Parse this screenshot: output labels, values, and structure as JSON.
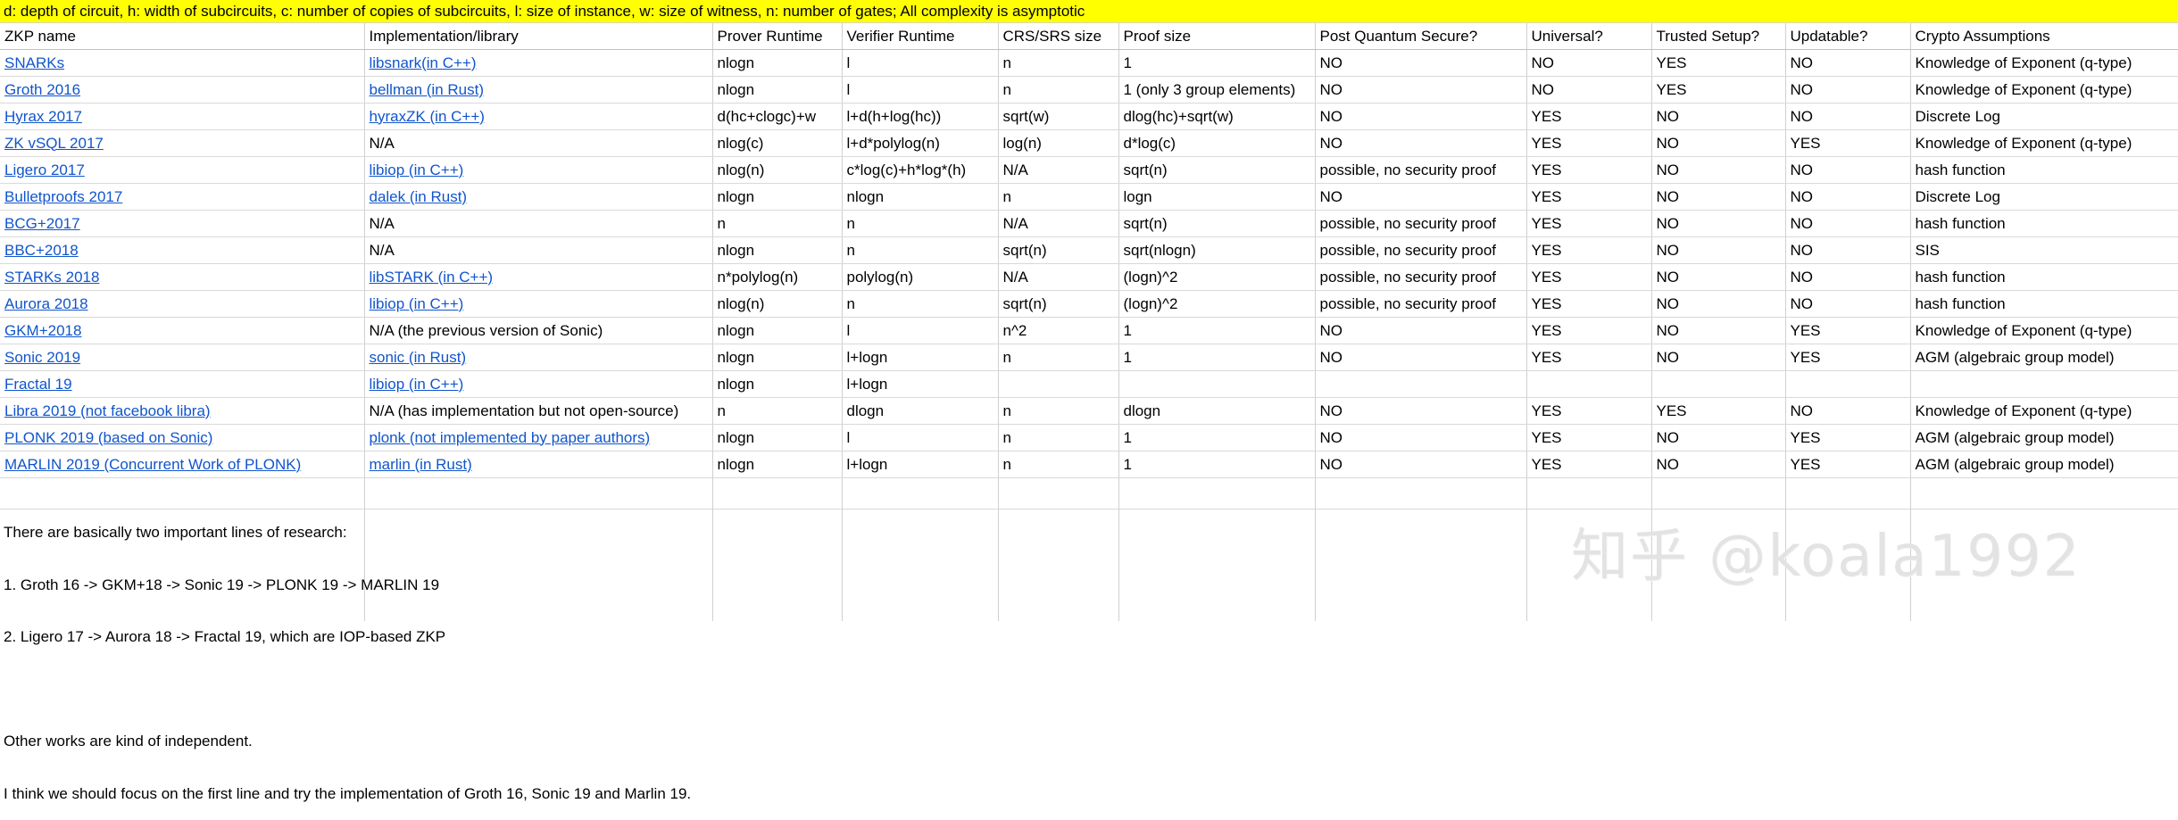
{
  "legend": {
    "text": "d: depth of circuit, h: width of subcircuits, c: number of copies of subcircuits, l: size of instance, w: size of witness, n: number of gates; All complexity is asymptotic",
    "background": "#ffff00"
  },
  "table": {
    "columns": [
      "ZKP name",
      "Implementation/library",
      "Prover Runtime",
      "Verifier Runtime",
      "CRS/SRS size",
      "Proof size",
      "Post Quantum Secure?",
      "Universal?",
      "Trusted Setup?",
      "Updatable?",
      "Crypto Assumptions"
    ],
    "link_color": "#1155cc",
    "rows": [
      {
        "name": "SNARKs ",
        "name_link": true,
        "impl": "libsnark(in C++)",
        "impl_link": true,
        "prover": "nlogn",
        "verifier": "l",
        "crs": "n",
        "proof": "1",
        "proof_numeric": true,
        "pq": "NO",
        "universal": "NO",
        "trusted": "YES",
        "updatable": "NO",
        "crypto": "Knowledge of Exponent (q-type)"
      },
      {
        "name": "Groth 2016",
        "name_link": true,
        "impl": "bellman (in Rust)",
        "impl_link": true,
        "prover": "nlogn",
        "verifier": "l",
        "crs": "n",
        "proof": "1 (only 3 group elements)",
        "proof_numeric": false,
        "pq": "NO",
        "universal": "NO",
        "trusted": "YES",
        "updatable": "NO",
        "crypto": "Knowledge of Exponent (q-type)"
      },
      {
        "name": "Hyrax 2017",
        "name_link": true,
        "impl": "hyraxZK (in C++)",
        "impl_link": true,
        "prover": "d(hc+clogc)+w",
        "verifier": "l+d(h+log(hc))",
        "crs": "sqrt(w)",
        "proof": "dlog(hc)+sqrt(w)",
        "proof_numeric": false,
        "pq": "NO",
        "universal": "YES",
        "trusted": "NO",
        "updatable": "NO",
        "crypto": "Discrete Log"
      },
      {
        "name": "ZK vSQL 2017",
        "name_link": true,
        "impl": "N/A",
        "impl_link": false,
        "prover": "nlog(c)",
        "verifier": "l+d*polylog(n)",
        "crs": "log(n)",
        "proof": "d*log(c)",
        "proof_numeric": false,
        "pq": "NO",
        "universal": "YES",
        "trusted": "NO",
        "updatable": "YES",
        "crypto": "Knowledge of Exponent (q-type)"
      },
      {
        "name": "Ligero 2017",
        "name_link": true,
        "impl": "libiop (in C++)",
        "impl_link": true,
        "prover": "nlog(n)",
        "verifier": "c*log(c)+h*log*(h)",
        "crs": "N/A",
        "proof": "sqrt(n)",
        "proof_numeric": false,
        "pq": "possible, no security proof",
        "universal": "YES",
        "trusted": "NO",
        "updatable": "NO",
        "crypto": "hash function"
      },
      {
        "name": "Bulletproofs 2017",
        "name_link": true,
        "impl": "dalek (in Rust)",
        "impl_link": true,
        "prover": "nlogn",
        "verifier": "nlogn",
        "crs": "n",
        "proof": "logn",
        "proof_numeric": false,
        "pq": "NO",
        "universal": "YES",
        "trusted": "NO",
        "updatable": "NO",
        "crypto": "Discrete Log"
      },
      {
        "name": "BCG+2017",
        "name_link": true,
        "impl": "N/A",
        "impl_link": false,
        "prover": "n",
        "verifier": "n",
        "crs": "N/A",
        "proof": "sqrt(n)",
        "proof_numeric": false,
        "pq": "possible, no security proof",
        "universal": "YES",
        "trusted": "NO",
        "updatable": "NO",
        "crypto": "hash function"
      },
      {
        "name": "BBC+2018",
        "name_link": true,
        "impl": "N/A",
        "impl_link": false,
        "prover": "nlogn",
        "verifier": "n",
        "crs": "sqrt(n)",
        "proof": "sqrt(nlogn)",
        "proof_numeric": false,
        "pq": "possible, no security proof",
        "universal": "YES",
        "trusted": "NO",
        "updatable": "NO",
        "crypto": "SIS"
      },
      {
        "name": "STARKs 2018",
        "name_link": true,
        "impl": "libSTARK (in C++)",
        "impl_link": true,
        "prover": "n*polylog(n)",
        "verifier": "polylog(n)",
        "crs": "N/A",
        "proof": "(logn)^2",
        "proof_numeric": false,
        "pq": "possible, no security proof",
        "universal": "YES",
        "trusted": "NO",
        "updatable": "NO",
        "crypto": "hash function"
      },
      {
        "name": "Aurora 2018",
        "name_link": true,
        "impl": "libiop (in C++)",
        "impl_link": true,
        "prover": "nlog(n)",
        "verifier": "n",
        "crs": "sqrt(n)",
        "proof": "(logn)^2",
        "proof_numeric": false,
        "pq": "possible, no security proof",
        "universal": "YES",
        "trusted": "NO",
        "updatable": "NO",
        "crypto": "hash function"
      },
      {
        "name": "GKM+2018",
        "name_link": true,
        "impl": "N/A (the previous version of Sonic)",
        "impl_link": false,
        "prover": "nlogn",
        "verifier": "l",
        "crs": "n^2",
        "proof": "1",
        "proof_numeric": true,
        "pq": "NO",
        "universal": "YES",
        "trusted": "NO",
        "updatable": "YES",
        "crypto": "Knowledge of Exponent (q-type)"
      },
      {
        "name": "Sonic 2019",
        "name_link": true,
        "impl": "sonic (in Rust)",
        "impl_link": true,
        "prover": "nlogn",
        "verifier": "l+logn",
        "crs": "n",
        "proof": "1",
        "proof_numeric": true,
        "pq": "NO",
        "universal": "YES",
        "trusted": "NO",
        "updatable": "YES",
        "crypto": "AGM (algebraic group model)"
      },
      {
        "name": "Fractal 19",
        "name_link": true,
        "impl": "libiop (in C++)",
        "impl_link": true,
        "prover": "nlogn",
        "verifier": "l+logn",
        "crs": "",
        "proof": "",
        "proof_numeric": false,
        "pq": "",
        "universal": "",
        "trusted": "",
        "updatable": "",
        "crypto": ""
      },
      {
        "name": "Libra 2019 (not facebook libra)",
        "name_link": true,
        "impl": "N/A (has implementation but not open-source)",
        "impl_link": false,
        "prover": "n",
        "verifier": "dlogn",
        "crs": "n",
        "proof": "dlogn",
        "proof_numeric": false,
        "pq": "NO",
        "universal": "YES",
        "trusted": "YES",
        "updatable": "NO",
        "crypto": "Knowledge of Exponent (q-type)"
      },
      {
        "name": "PLONK 2019 (based on Sonic)",
        "name_link": true,
        "impl": "plonk (not implemented by paper authors)",
        "impl_link": true,
        "prover": "nlogn",
        "verifier": "l",
        "crs": "n",
        "proof": "1",
        "proof_numeric": true,
        "pq": "NO",
        "universal": "YES",
        "trusted": "NO",
        "updatable": "YES",
        "crypto": "AGM (algebraic group model)"
      },
      {
        "name": "MARLIN 2019 (Concurrent Work of PLONK)",
        "name_link": true,
        "impl": "marlin (in Rust)",
        "impl_link": true,
        "prover": "nlogn",
        "verifier": "l+logn",
        "crs": "n",
        "proof": "1",
        "proof_numeric": true,
        "pq": "NO",
        "universal": "YES",
        "trusted": "NO",
        "updatable": "YES",
        "crypto": "AGM (algebraic group model)"
      }
    ]
  },
  "notes": {
    "line1": "There are basically two important lines of research:",
    "line2": "1. Groth 16 -> GKM+18 -> Sonic 19 -> PLONK 19 -> MARLIN 19",
    "line3": "2. Ligero 17 -> Aurora 18 -> Fractal 19, which are IOP-based ZKP",
    "line4": "",
    "line5": "Other works are kind of independent.",
    "line6": "I think we should focus on the first line and try the implementation of Groth 16, Sonic 19 and Marlin 19."
  },
  "watermark": {
    "text": "知乎 @koala1992",
    "color": "#e3e3e3"
  }
}
